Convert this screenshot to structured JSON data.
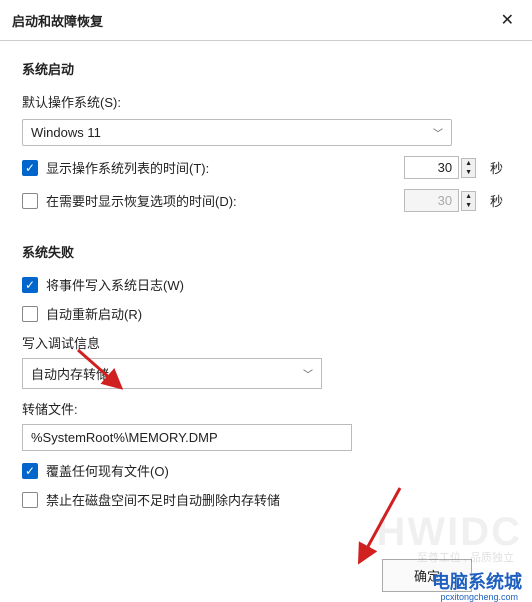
{
  "window": {
    "title": "启动和故障恢复"
  },
  "startup": {
    "group_title": "系统启动",
    "default_os_label": "默认操作系统(S):",
    "default_os_value": "Windows 11",
    "show_os_list": {
      "checked": true,
      "label": "显示操作系统列表的时间(T):",
      "value": "30",
      "unit": "秒"
    },
    "show_recovery": {
      "checked": false,
      "label": "在需要时显示恢复选项的时间(D):",
      "value": "30",
      "unit": "秒"
    }
  },
  "failure": {
    "group_title": "系统失败",
    "write_log": {
      "checked": true,
      "label": "将事件写入系统日志(W)"
    },
    "auto_restart": {
      "checked": false,
      "label": "自动重新启动(R)"
    },
    "debug_label": "写入调试信息",
    "memdump_value": "自动内存转储",
    "dump_file_label": "转储文件:",
    "dump_file_value": "%SystemRoot%\\MEMORY.DMP",
    "overwrite": {
      "checked": true,
      "label": "覆盖任何现有文件(O)"
    },
    "nodisk": {
      "checked": false,
      "label": "禁止在磁盘空间不足时自动删除内存转储"
    }
  },
  "buttons": {
    "ok": "确定"
  },
  "branding": {
    "big": "HWIDC",
    "sub": "至尊工位 , 品质独立",
    "site": "电脑系统城",
    "url": "pcxitongcheng.com"
  }
}
